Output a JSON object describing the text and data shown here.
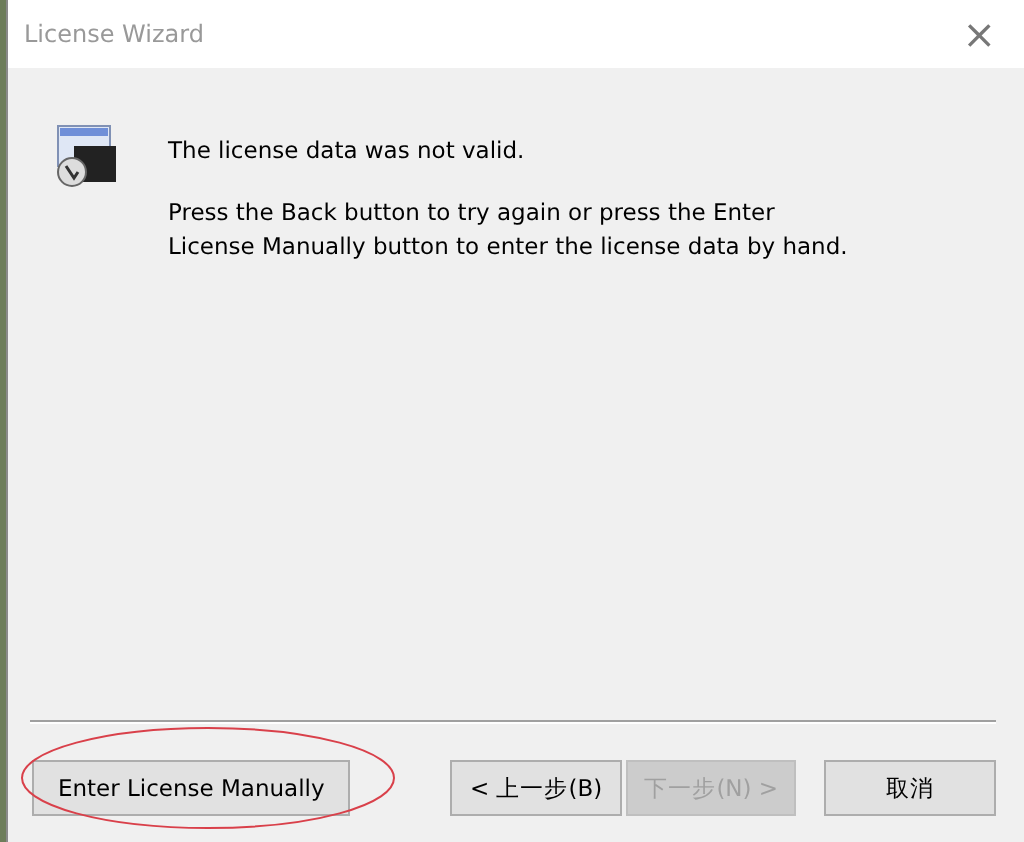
{
  "window": {
    "title": "License Wizard",
    "close": "×"
  },
  "messages": [
    "The license data was not valid.",
    "Press the Back button to try again or press the Enter License Manually button to enter the license data by hand."
  ],
  "buttons": [
    {
      "label": "Enter License Manually",
      "disabled": false,
      "kind": "extra"
    },
    {
      "label": "< 上一步(B)",
      "disabled": false,
      "kind": "nav"
    },
    {
      "label": "下一步(N) >",
      "disabled": true,
      "kind": "nav"
    },
    {
      "label": "取消",
      "disabled": false,
      "kind": "cancel"
    }
  ]
}
